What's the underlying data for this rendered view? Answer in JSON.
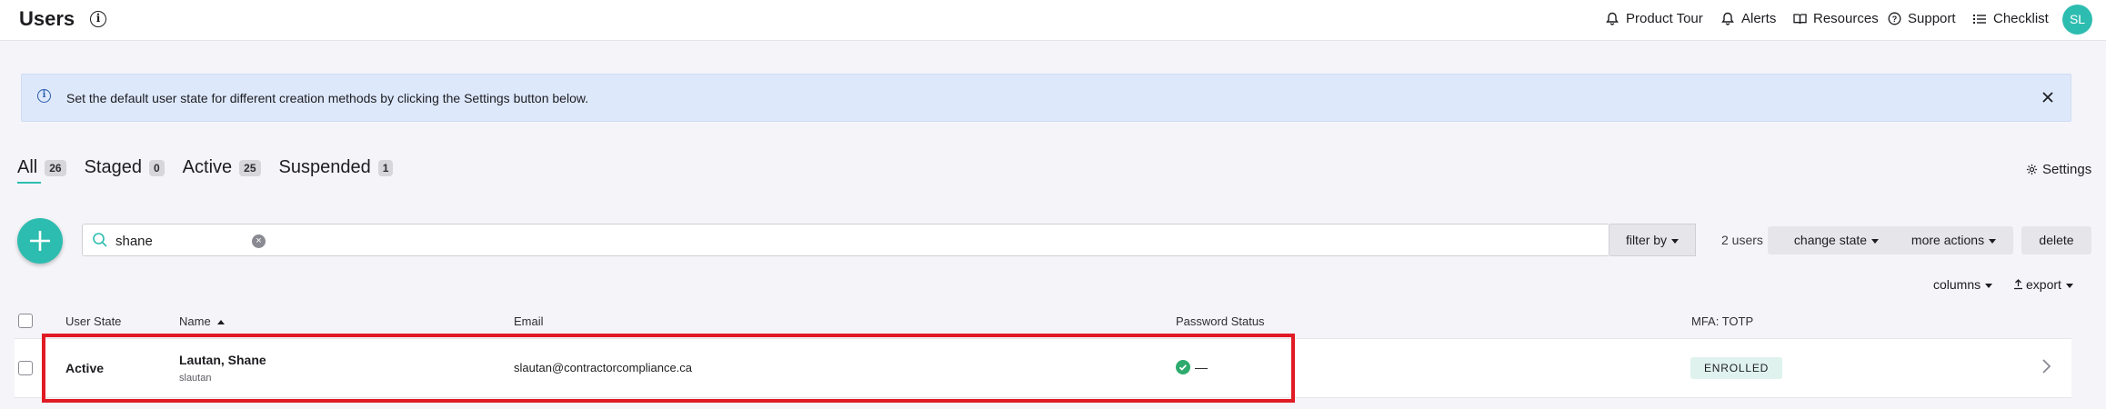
{
  "header": {
    "title": "Users",
    "nav": [
      {
        "label": "Product Tour",
        "icon": "bell-tour-icon"
      },
      {
        "label": "Alerts",
        "icon": "bell-icon"
      },
      {
        "label": "Resources",
        "icon": "book-icon"
      },
      {
        "label": "Support",
        "icon": "question-circle-icon"
      },
      {
        "label": "Checklist",
        "icon": "list-icon"
      }
    ],
    "avatar_initials": "SL"
  },
  "banner": {
    "text": "Set the default user state for different creation methods by clicking the Settings button below."
  },
  "tabs": [
    {
      "label": "All",
      "count": "26",
      "active": true
    },
    {
      "label": "Staged",
      "count": "0"
    },
    {
      "label": "Active",
      "count": "25"
    },
    {
      "label": "Suspended",
      "count": "1"
    }
  ],
  "settings_label": "Settings",
  "toolbar": {
    "search_value": "shane",
    "filter_label": "filter by",
    "user_count": "2 users",
    "change_state_label": "change state",
    "more_actions_label": "more actions",
    "delete_label": "delete",
    "columns_label": "columns",
    "export_label": "export"
  },
  "table": {
    "headers": [
      "User State",
      "Name",
      "Email",
      "Password Status",
      "MFA: TOTP"
    ],
    "rows": [
      {
        "state": "Active",
        "name": "Lautan, Shane",
        "username": "slautan",
        "email": "slautan@contractorcompliance.ca",
        "password_status": "—",
        "mfa": "ENROLLED"
      }
    ]
  },
  "colors": {
    "accent": "#2dbdb0",
    "banner_bg": "#dde8fb",
    "highlight": "#e01b24",
    "success": "#2eaa6e"
  }
}
